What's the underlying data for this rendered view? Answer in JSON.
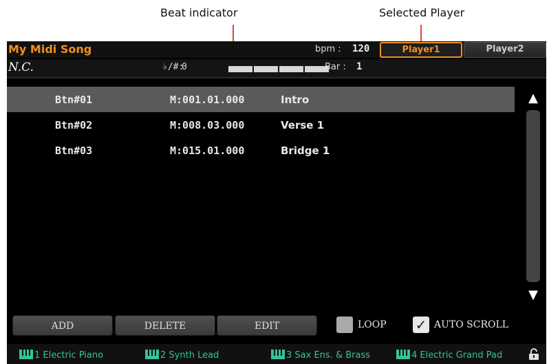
{
  "callouts": {
    "beat_indicator": "Beat indicator",
    "selected_player": "Selected Player"
  },
  "header": {
    "song_title": "My Midi Song",
    "bpm_label": "bpm :",
    "bpm_value": "120",
    "player_tabs": [
      "Player1",
      "Player2"
    ],
    "selected_player": "Player1",
    "chord": "N.C.",
    "accidental_label": "♭/#:",
    "accidental_value": "0",
    "beats_total": 4,
    "bar_label": "Bar :",
    "bar_value": "1"
  },
  "markers": [
    {
      "button": "Btn#01",
      "position": "M:001.01.000",
      "name": "Intro",
      "selected": true
    },
    {
      "button": "Btn#02",
      "position": "M:008.03.000",
      "name": "Verse 1",
      "selected": false
    },
    {
      "button": "Btn#03",
      "position": "M:015.01.000",
      "name": "Bridge 1",
      "selected": false
    }
  ],
  "scrollbar": {
    "up_icon": "▲",
    "down_icon": "▼"
  },
  "footer": {
    "add_label": "ADD",
    "delete_label": "DELETE",
    "edit_label": "EDIT",
    "loop_label": "LOOP",
    "loop_checked": false,
    "autoscroll_label": "AUTO SCROLL",
    "autoscroll_checked": true
  },
  "tracks": [
    {
      "num": "1",
      "name": "Electric Piano"
    },
    {
      "num": "2",
      "name": "Synth Lead"
    },
    {
      "num": "3",
      "name": "Sax Ens. & Brass"
    },
    {
      "num": "4",
      "name": "Electric Grand Pad"
    }
  ],
  "colors": {
    "accent": "#f0911f",
    "track_text": "#34c49a",
    "callout_line": "#e0432b",
    "selected_row": "#5a5a5a"
  }
}
